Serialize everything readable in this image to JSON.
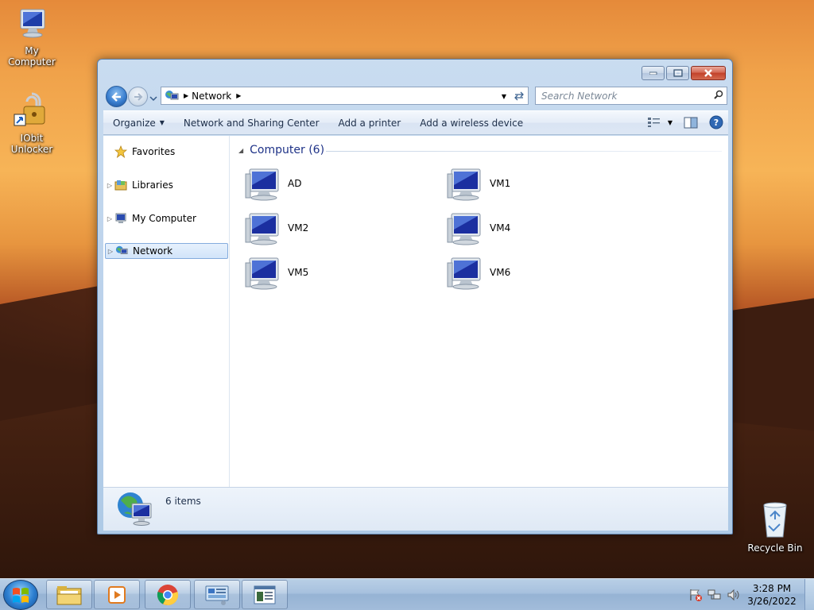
{
  "desktop": {
    "icons": [
      {
        "label": "My Computer"
      },
      {
        "label": "IObit\nUnlocker"
      },
      {
        "label": "Recycle Bin"
      }
    ]
  },
  "window": {
    "address": {
      "crumb": "Network"
    },
    "search": {
      "placeholder": "Search Network"
    },
    "toolbar": {
      "organize": "Organize",
      "network_sharing": "Network and Sharing Center",
      "add_printer": "Add a printer",
      "add_wireless": "Add a wireless device"
    },
    "navpane": {
      "items": [
        {
          "label": "Favorites"
        },
        {
          "label": "Libraries"
        },
        {
          "label": "My Computer"
        },
        {
          "label": "Network",
          "selected": true
        }
      ]
    },
    "content": {
      "group_header": "Computer (6)",
      "computers": [
        {
          "name": "AD"
        },
        {
          "name": "VM1"
        },
        {
          "name": "VM2"
        },
        {
          "name": "VM4"
        },
        {
          "name": "VM5"
        },
        {
          "name": "VM6"
        }
      ]
    },
    "details": {
      "items_text": "6 items"
    }
  },
  "taskbar": {
    "clock": {
      "time": "3:28 PM",
      "date": "3/26/2022"
    }
  }
}
